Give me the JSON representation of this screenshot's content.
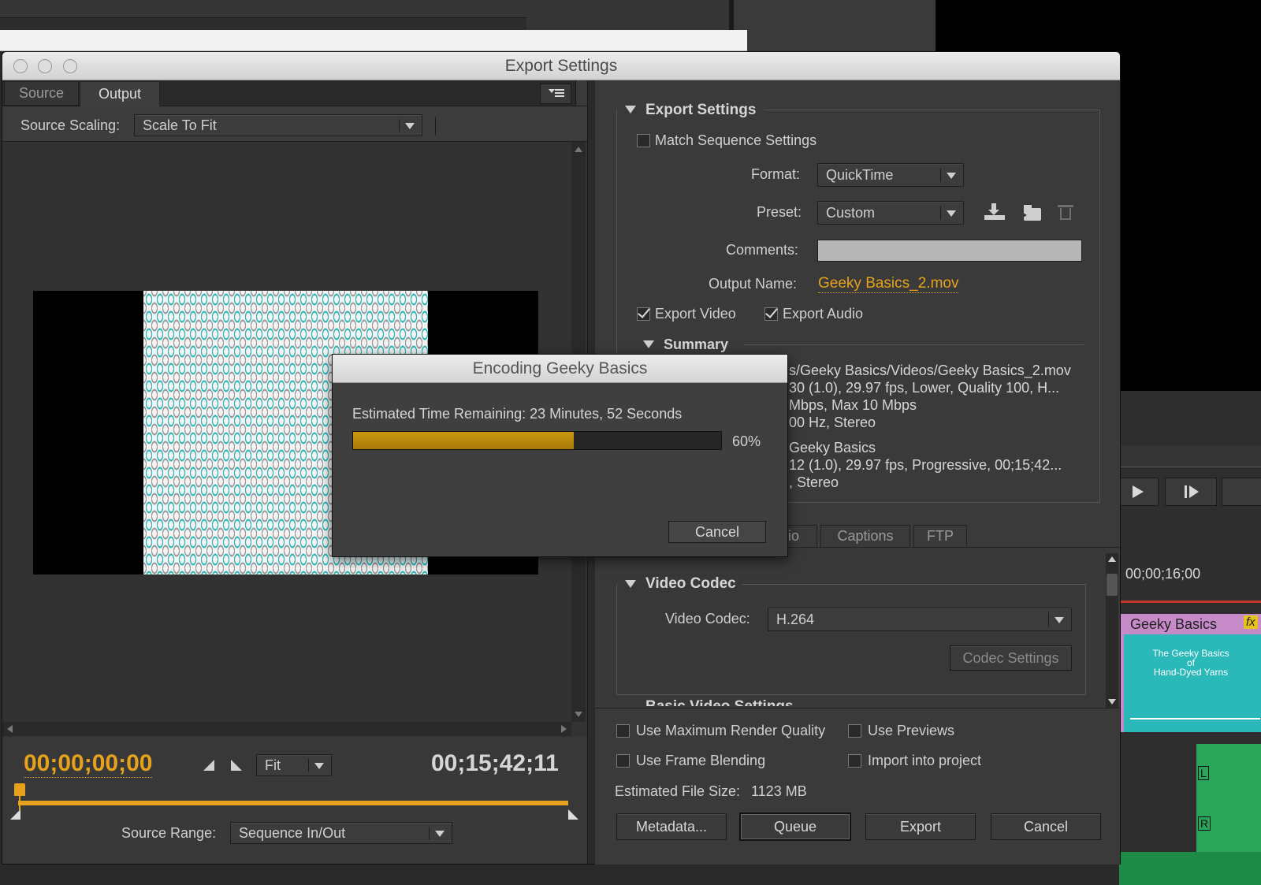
{
  "window": {
    "title": "Export Settings"
  },
  "left_tabs": {
    "source": "Source",
    "output": "Output"
  },
  "source_scaling": {
    "label": "Source Scaling:",
    "value": "Scale To Fit"
  },
  "timeline": {
    "current_time": "00;00;00;00",
    "fit_value": "Fit",
    "duration": "00;15;42;11"
  },
  "source_range": {
    "label": "Source Range:",
    "value": "Sequence In/Out"
  },
  "export_settings": {
    "section_title": "Export Settings",
    "match_sequence": "Match Sequence Settings",
    "format_label": "Format:",
    "format_value": "QuickTime",
    "preset_label": "Preset:",
    "preset_value": "Custom",
    "comments_label": "Comments:",
    "output_name_label": "Output Name:",
    "output_name_value": "Geeky Basics_2.mov",
    "export_video": "Export Video",
    "export_audio": "Export Audio",
    "summary_title": "Summary",
    "summary_lines": [
      "s/Geeky Basics/Videos/Geeky Basics_2.mov",
      "30 (1.0), 29.97 fps, Lower, Quality 100, H...",
      " Mbps, Max 10 Mbps",
      "00 Hz, Stereo",
      "Geeky Basics",
      "12 (1.0), 29.97 fps, Progressive, 00;15;42...",
      ", Stereo"
    ]
  },
  "settings_tabs": {
    "audio_partial": "io",
    "captions": "Captions",
    "ftp": "FTP"
  },
  "video_codec": {
    "section_title": "Video Codec",
    "label": "Video Codec:",
    "value": "H.264",
    "codec_settings": "Codec Settings",
    "basic_partial": "Basic Video Settings"
  },
  "options": {
    "max_render": "Use Maximum Render Quality",
    "use_previews": "Use Previews",
    "frame_blending": "Use Frame Blending",
    "import_project": "Import into project",
    "file_size_label": "Estimated File Size:",
    "file_size_value": "1123 MB"
  },
  "buttons": {
    "metadata": "Metadata...",
    "queue": "Queue",
    "export": "Export",
    "cancel": "Cancel"
  },
  "encoding_dialog": {
    "title": "Encoding Geeky Basics",
    "time_remaining": "Estimated Time Remaining: 23 Minutes, 52 Seconds",
    "progress_value": 0.6,
    "progress_text": "60%",
    "cancel": "Cancel"
  },
  "background_panel": {
    "timecode": "00;00;16;00",
    "clip_name": "Geeky Basics",
    "clip_fx": "fx",
    "thumb_line1": "The Geeky Basics",
    "thumb_line2": "of",
    "thumb_line3": "Hand-Dyed Yarns",
    "track_l": "L",
    "track_r": "R"
  },
  "colors": {
    "accent_orange": "#e6a21c",
    "progress_fill": "#b98a10",
    "clip_purple": "#c68ac9",
    "teal": "#2ab8b8"
  }
}
